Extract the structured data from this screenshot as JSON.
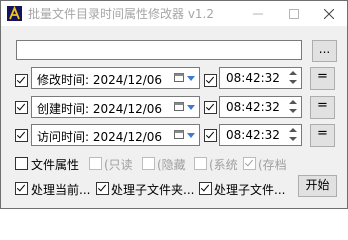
{
  "window": {
    "title": "批量文件目录时间属性修改器 v1.2"
  },
  "path": {
    "value": "",
    "browse_label": "..."
  },
  "rows": [
    {
      "label": "修改时间:",
      "date": "2024/12/06",
      "time": "08:42:32",
      "eq": "=",
      "checked": true,
      "time_checked": true
    },
    {
      "label": "创建时间:",
      "date": "2024/12/06",
      "time": "08:42:32",
      "eq": "=",
      "checked": true,
      "time_checked": true
    },
    {
      "label": "访问时间:",
      "date": "2024/12/06",
      "time": "08:42:32",
      "eq": "=",
      "checked": true,
      "time_checked": true
    }
  ],
  "attributes": {
    "label": "文件属性",
    "checked": false,
    "options": [
      {
        "label": "(只读",
        "checked": false
      },
      {
        "label": "(隐藏",
        "checked": false
      },
      {
        "label": "(系统",
        "checked": false
      },
      {
        "label": "(存档",
        "checked": true
      }
    ]
  },
  "options": [
    {
      "label": "处理当前...",
      "checked": true
    },
    {
      "label": "处理子文件夹...",
      "checked": true
    },
    {
      "label": "处理子文件...",
      "checked": true
    }
  ],
  "start_label": "开始",
  "colors": {
    "accent": "#3c7bd1",
    "title_text": "#a6a6a6",
    "disabled_text": "#a0a0a0"
  }
}
